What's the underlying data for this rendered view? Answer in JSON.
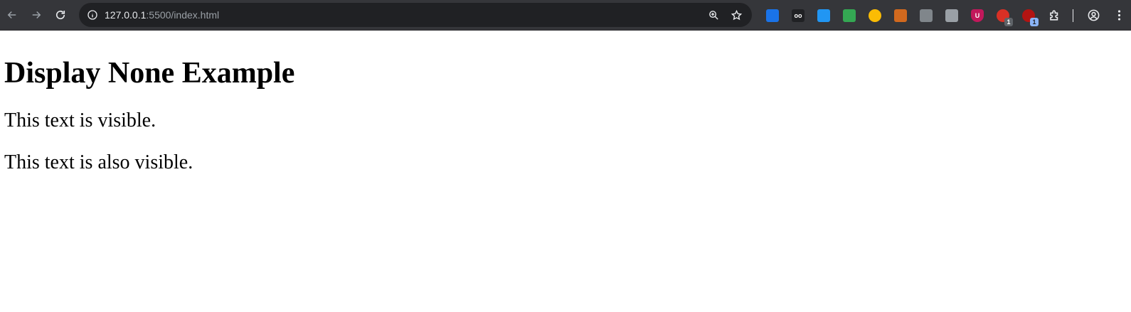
{
  "browser": {
    "url_host": "127.0.0.1",
    "url_rest": ":5500/index.html",
    "icons": {
      "back": "back-arrow-icon",
      "forward": "forward-arrow-icon",
      "reload": "reload-icon",
      "site_info": "site-info-icon",
      "zoom": "zoom-icon",
      "bookmark": "star-icon",
      "profile": "profile-icon",
      "menu": "kebab-menu-icon",
      "extensions": "puzzle-icon"
    },
    "extensions": [
      {
        "name": "screen-capture-extension",
        "color": "#1a73e8",
        "glyph": "",
        "badge": ""
      },
      {
        "name": "tampermonkey-extension",
        "color": "#202124",
        "glyph": "oo",
        "badge": ""
      },
      {
        "name": "ext-blue-extension",
        "color": "#2196f3",
        "glyph": "",
        "badge": ""
      },
      {
        "name": "ext-green-yellow-extension",
        "color": "#34a853",
        "glyph": "",
        "badge": ""
      },
      {
        "name": "ext-circle-extension",
        "color": "#fbbc04",
        "glyph": "",
        "badge": ""
      },
      {
        "name": "cookie-extension",
        "color": "#d2691e",
        "glyph": "",
        "badge": ""
      },
      {
        "name": "ext-gray-extension",
        "color": "#80868b",
        "glyph": "",
        "badge": ""
      },
      {
        "name": "ext-copy-extension",
        "color": "#9aa0a6",
        "glyph": "",
        "badge": ""
      },
      {
        "name": "ublock-extension",
        "color": "#c2185b",
        "glyph": "U",
        "badge": ""
      },
      {
        "name": "ext-red-extension",
        "color": "#d93025",
        "glyph": "",
        "badge": "1"
      },
      {
        "name": "ext-darkred-extension",
        "color": "#b31412",
        "glyph": "",
        "badge": "1"
      }
    ]
  },
  "page": {
    "heading": "Display None Example",
    "paragraphs": [
      "This text is visible.",
      "This text is also visible."
    ]
  }
}
